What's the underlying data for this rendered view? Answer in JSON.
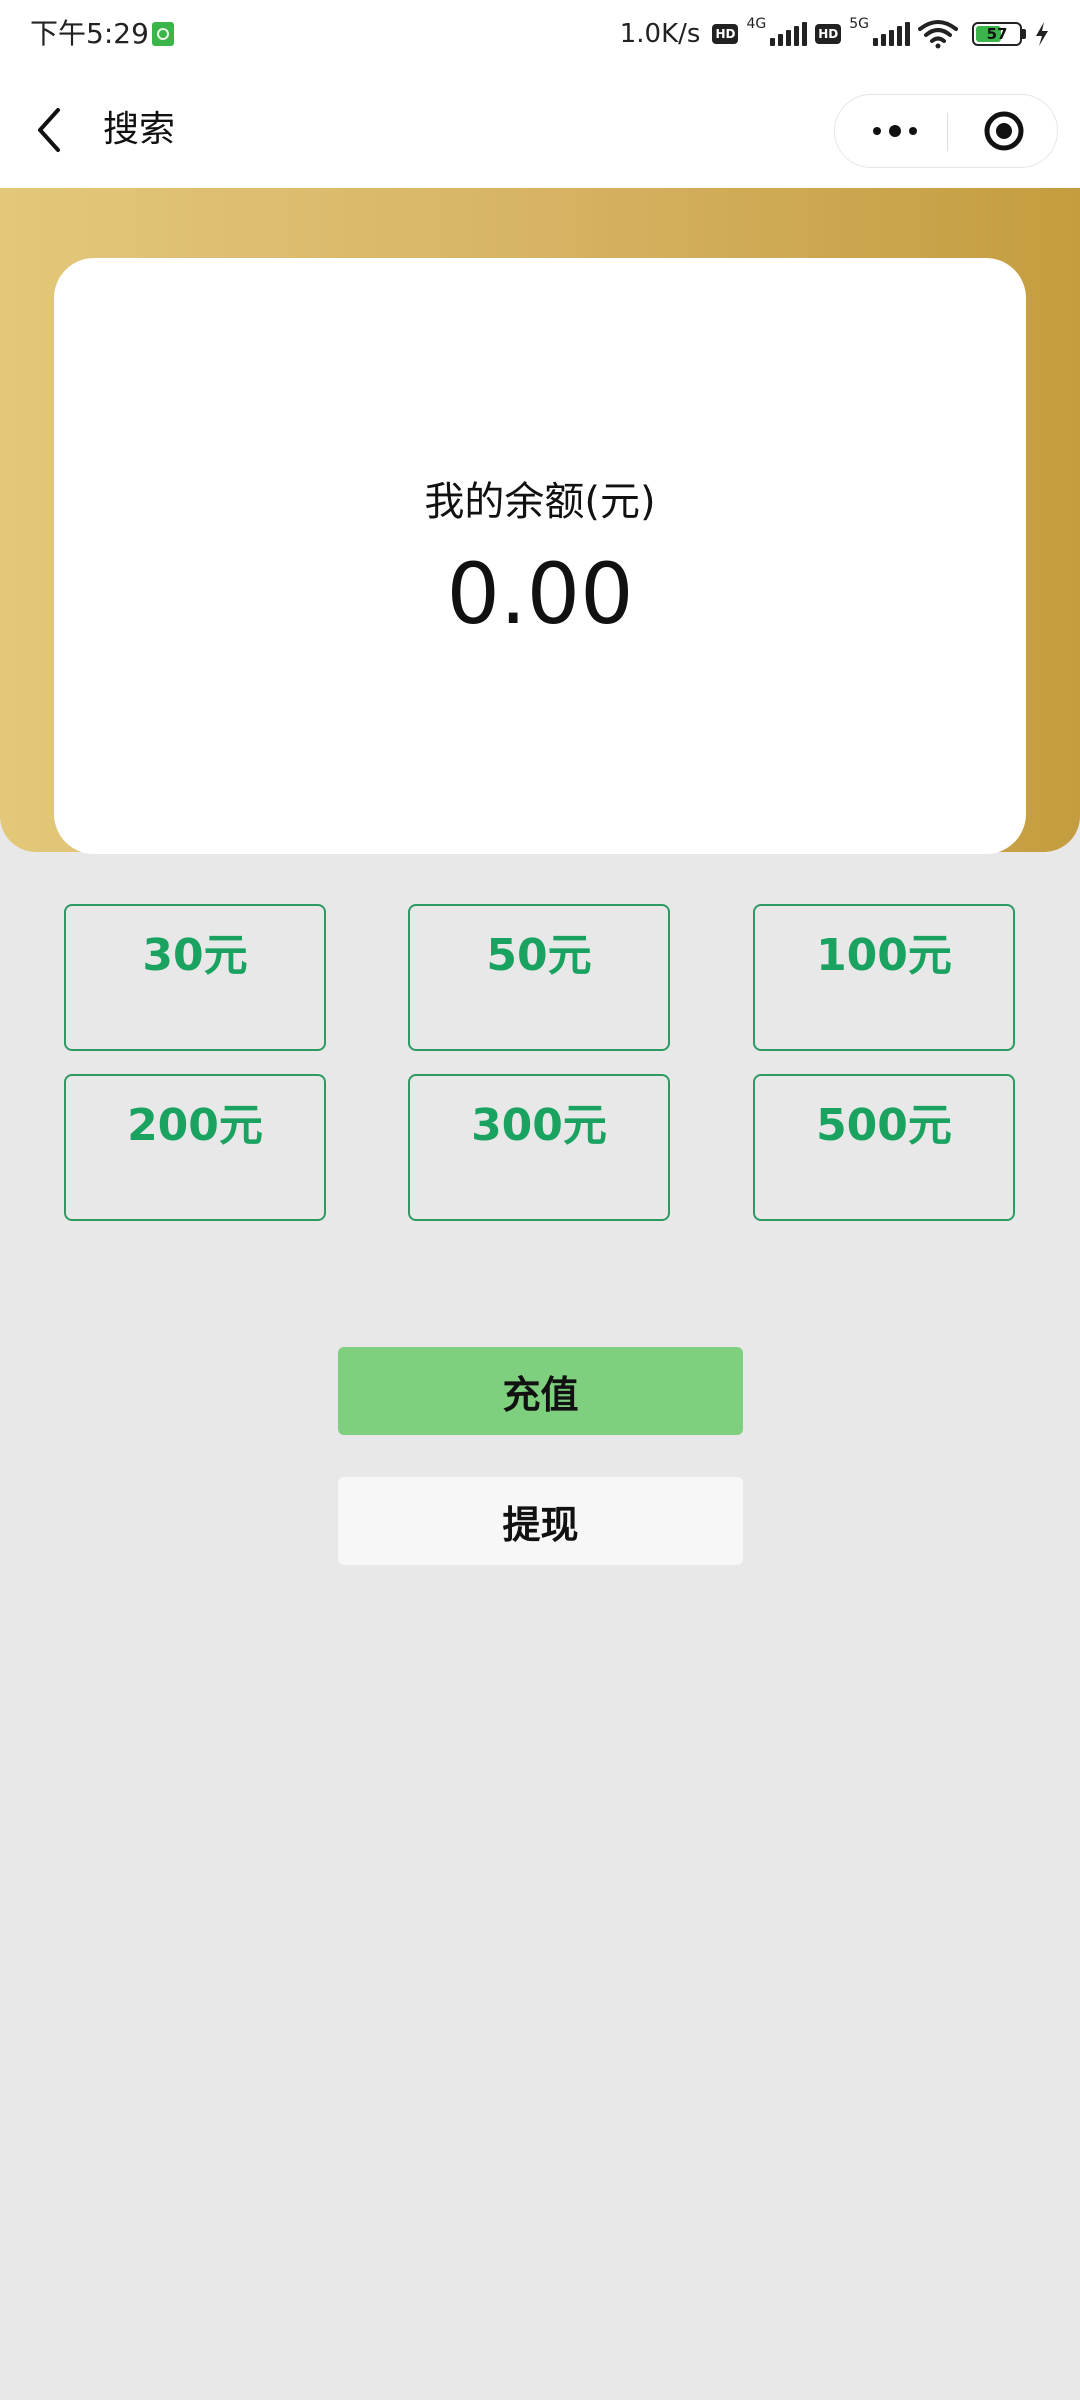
{
  "status_bar": {
    "time": "下午5:29",
    "net_speed": "1.0K/s",
    "hd1": "HD",
    "net1": "4G",
    "hd2": "HD",
    "net2": "5G",
    "battery": "57"
  },
  "nav": {
    "title": "搜索"
  },
  "balance": {
    "label": "我的余额(元)",
    "value": "0.00"
  },
  "amounts": [
    "30元",
    "50元",
    "100元",
    "200元",
    "300元",
    "500元"
  ],
  "actions": {
    "recharge": "充值",
    "withdraw": "提现"
  },
  "colors": {
    "accent_green": "#1aa260",
    "recharge_bg": "#7ed07e",
    "gold_start": "#e3c87a",
    "gold_end": "#c49d3f",
    "page_bg": "#e8e8e8"
  }
}
